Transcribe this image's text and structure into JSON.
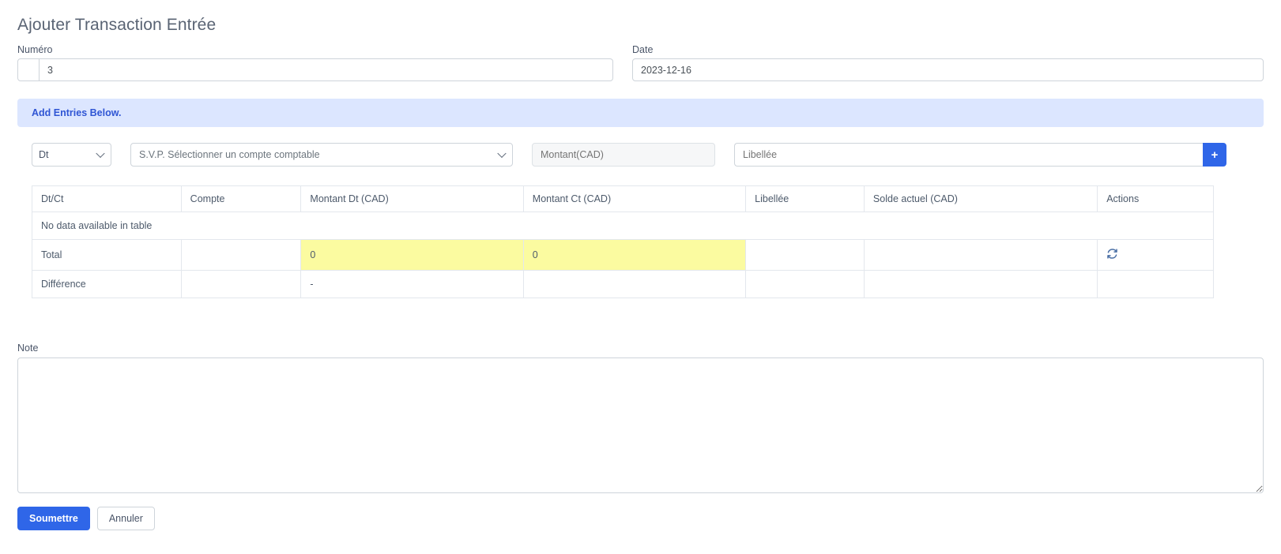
{
  "page": {
    "title": "Ajouter Transaction Entrée"
  },
  "form": {
    "numero": {
      "label": "Numéro",
      "value": "3",
      "placeholder": ""
    },
    "date": {
      "label": "Date",
      "value": "2023-12-16",
      "placeholder": ""
    }
  },
  "alert": {
    "text": "Add Entries Below."
  },
  "entry_row": {
    "dtct_select": {
      "value": "Dt",
      "icon": "chevron-down-icon"
    },
    "account_select": {
      "value": "S.V.P. Sélectionner un compte comptable",
      "icon": "chevron-down-icon"
    },
    "montant": {
      "placeholder": "Montant(CAD)",
      "value": ""
    },
    "libellee": {
      "placeholder": "Libellée",
      "value": ""
    },
    "add_button": {
      "label": "+",
      "icon": "plus-icon"
    }
  },
  "table": {
    "headers": [
      "Dt/Ct",
      "Compte",
      "Montant Dt (CAD)",
      "Montant Ct (CAD)",
      "Libellée",
      "Solde actuel (CAD)",
      "Actions"
    ],
    "empty_message": "No data available in table",
    "total": {
      "label": "Total",
      "compte": "",
      "montant_dt": "0",
      "montant_ct": "0",
      "libellee": "",
      "solde": "",
      "action_icon": "refresh-icon"
    },
    "difference": {
      "label": "Différence",
      "compte": "",
      "montant_dt": "-",
      "montant_ct": "",
      "libellee": "",
      "solde": "",
      "actions": ""
    }
  },
  "note": {
    "label": "Note",
    "value": "",
    "placeholder": ""
  },
  "buttons": {
    "submit": "Soumettre",
    "cancel": "Annuler"
  },
  "colors": {
    "accent": "#2f66e8",
    "alert_bg": "#dce6ff",
    "alert_text": "#2f55d4",
    "highlight": "#fbfba0",
    "border": "#ced4da"
  }
}
